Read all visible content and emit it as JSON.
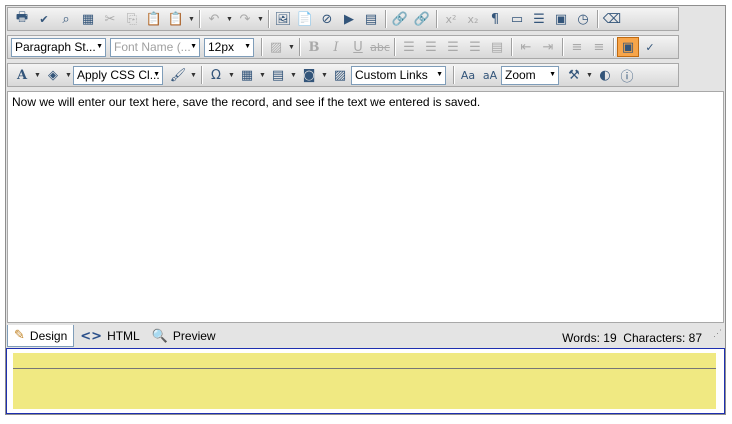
{
  "toolbar": {
    "paragraph_style": "Paragraph St...",
    "font_name": "Font Name (...",
    "font_size": "12px",
    "css_class": "Apply CSS Cl...",
    "custom_links": "Custom Links",
    "zoom": "Zoom"
  },
  "editor": {
    "content": "Now we will enter our text here, save the record, and see if the text we entered is saved."
  },
  "tabs": {
    "design": "Design",
    "html": "HTML",
    "preview": "Preview"
  },
  "stats": {
    "text": "Words: 19  Characters: 87"
  }
}
